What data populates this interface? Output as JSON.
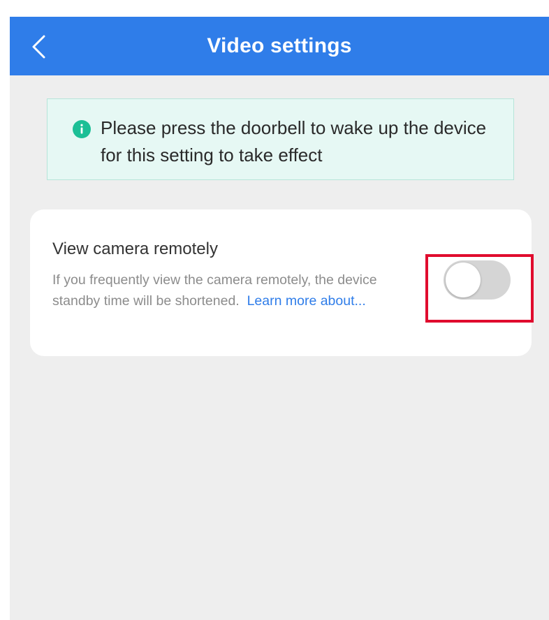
{
  "header": {
    "title": "Video settings",
    "back_icon": "chevron-left-icon",
    "background_color": "#2f7de9"
  },
  "notice": {
    "icon": "info-icon",
    "text": "Please press the doorbell to wake up the device for this setting to take effect",
    "background_color": "#e6f8f4",
    "icon_color": "#1cbf96"
  },
  "remote_view": {
    "title": "View camera remotely",
    "description": "If you frequently view the camera remotely, the device standby time will be shortened.",
    "link_text": "Learn more about...",
    "link_color": "#2f7de9",
    "toggle_on": false
  },
  "highlight": {
    "color": "#e00c2e"
  }
}
